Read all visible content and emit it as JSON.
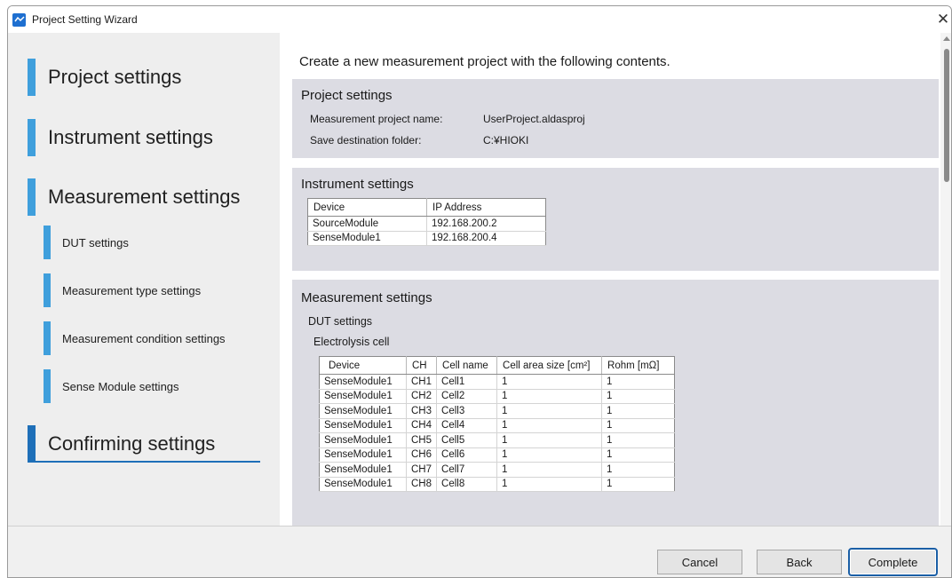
{
  "window": {
    "title": "Project Setting Wizard"
  },
  "sidebar": {
    "steps": [
      {
        "label": "Project settings"
      },
      {
        "label": "Instrument settings"
      },
      {
        "label": "Measurement settings"
      },
      {
        "label": "DUT settings"
      },
      {
        "label": "Measurement type settings"
      },
      {
        "label": "Measurement condition settings"
      },
      {
        "label": "Sense Module settings"
      },
      {
        "label": "Confirming settings",
        "active": true
      }
    ]
  },
  "content": {
    "intro": "Create a new measurement project with the following contents.",
    "project_settings": {
      "title": "Project settings",
      "name_label": "Measurement project name:",
      "name_value": "UserProject.aldasproj",
      "folder_label": "Save destination folder:",
      "folder_value": "C:¥HIOKI"
    },
    "instrument_settings": {
      "title": "Instrument settings",
      "columns": [
        "Device",
        "IP Address"
      ],
      "rows": [
        [
          "SourceModule",
          "192.168.200.2"
        ],
        [
          "SenseModule1",
          "192.168.200.4"
        ]
      ]
    },
    "measurement_settings": {
      "title": "Measurement settings",
      "dut_title": "DUT settings",
      "cell_title": "Electrolysis cell",
      "columns": [
        "Device",
        "CH",
        "Cell name",
        "Cell area size [cm²]",
        "Rohm [mΩ]"
      ],
      "rows": [
        [
          "SenseModule1",
          "CH1",
          "Cell1",
          "1",
          "1"
        ],
        [
          "SenseModule1",
          "CH2",
          "Cell2",
          "1",
          "1"
        ],
        [
          "SenseModule1",
          "CH3",
          "Cell3",
          "1",
          "1"
        ],
        [
          "SenseModule1",
          "CH4",
          "Cell4",
          "1",
          "1"
        ],
        [
          "SenseModule1",
          "CH5",
          "Cell5",
          "1",
          "1"
        ],
        [
          "SenseModule1",
          "CH6",
          "Cell6",
          "1",
          "1"
        ],
        [
          "SenseModule1",
          "CH7",
          "Cell7",
          "1",
          "1"
        ],
        [
          "SenseModule1",
          "CH8",
          "Cell8",
          "1",
          "1"
        ]
      ]
    }
  },
  "footer": {
    "cancel_label": "Cancel",
    "back_label": "Back",
    "complete_label": "Complete"
  },
  "colors": {
    "step_bar": "#3f9fdc",
    "active_step": "#1e6fb8",
    "section_bg": "#dcdce3"
  }
}
